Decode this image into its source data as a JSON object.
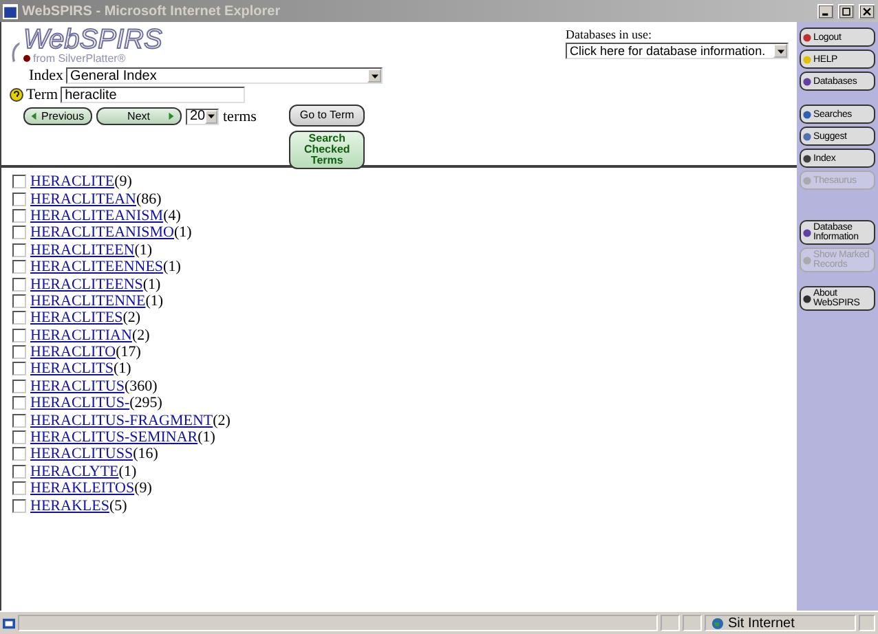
{
  "window": {
    "title": "WebSPIRS - Microsoft Internet Explorer"
  },
  "logo": {
    "name": "WebSPIRS",
    "tagline": "from SilverPlatter®"
  },
  "search": {
    "index_label": "Index",
    "index_value": "General Index",
    "term_label": "Term",
    "term_value": "heraclite",
    "go_button": "Go to Term",
    "search_button": "Search Checked Terms",
    "previous": "Previous",
    "next": "Next",
    "page_size": "20",
    "page_size_label": "terms"
  },
  "databases": {
    "label": "Databases in use:",
    "value": "Click here for database information."
  },
  "nav": [
    {
      "label": "Logout",
      "disabled": false
    },
    {
      "label": "HELP",
      "disabled": false
    },
    {
      "label": "Databases",
      "disabled": false
    },
    {
      "label": "Searches",
      "disabled": false
    },
    {
      "label": "Suggest",
      "disabled": false
    },
    {
      "label": "Index",
      "disabled": false
    },
    {
      "label": "Thesaurus",
      "disabled": true
    },
    {
      "label": "Database Information",
      "disabled": false
    },
    {
      "label": "Show Marked Records",
      "disabled": true
    },
    {
      "label": "About WebSPIRS",
      "disabled": false
    }
  ],
  "terms": [
    {
      "term": "HERACLITE",
      "count": "(9)",
      "checked": false
    },
    {
      "term": "HERACLITEAN",
      "count": "(86)",
      "checked": false
    },
    {
      "term": "HERACLITEANISM",
      "count": "(4)",
      "checked": false
    },
    {
      "term": "HERACLITEANISMO",
      "count": "(1)",
      "checked": false
    },
    {
      "term": "HERACLITEEN",
      "count": "(1)",
      "checked": false
    },
    {
      "term": "HERACLITEENNES",
      "count": "(1)",
      "checked": false
    },
    {
      "term": "HERACLITEENS",
      "count": "(1)",
      "checked": false
    },
    {
      "term": "HERACLITENNE",
      "count": "(1)",
      "checked": false
    },
    {
      "term": "HERACLITES",
      "count": "(2)",
      "checked": false
    },
    {
      "term": "HERACLITIAN",
      "count": "(2)",
      "checked": false
    },
    {
      "term": "HERACLITO",
      "count": "(17)",
      "checked": false
    },
    {
      "term": "HERACLITS",
      "count": "(1)",
      "checked": false
    },
    {
      "term": "HERACLITUS",
      "count": "(360)",
      "checked": false
    },
    {
      "term": "HERACLITUS-",
      "count": "(295)",
      "checked": false
    },
    {
      "term": "HERACLITUS-FRAGMENT",
      "count": "(2)",
      "checked": false
    },
    {
      "term": "HERACLITUS-SEMINAR",
      "count": "(1)",
      "checked": false
    },
    {
      "term": "HERACLITUSS",
      "count": "(16)",
      "checked": false
    },
    {
      "term": "HERACLYTE",
      "count": "(1)",
      "checked": false
    },
    {
      "term": "HERAKLEITOS",
      "count": "(9)",
      "checked": false
    },
    {
      "term": "HERAKLES",
      "count": "(5)",
      "checked": false
    }
  ],
  "status_bar": {
    "zone": "Sit Internet"
  }
}
